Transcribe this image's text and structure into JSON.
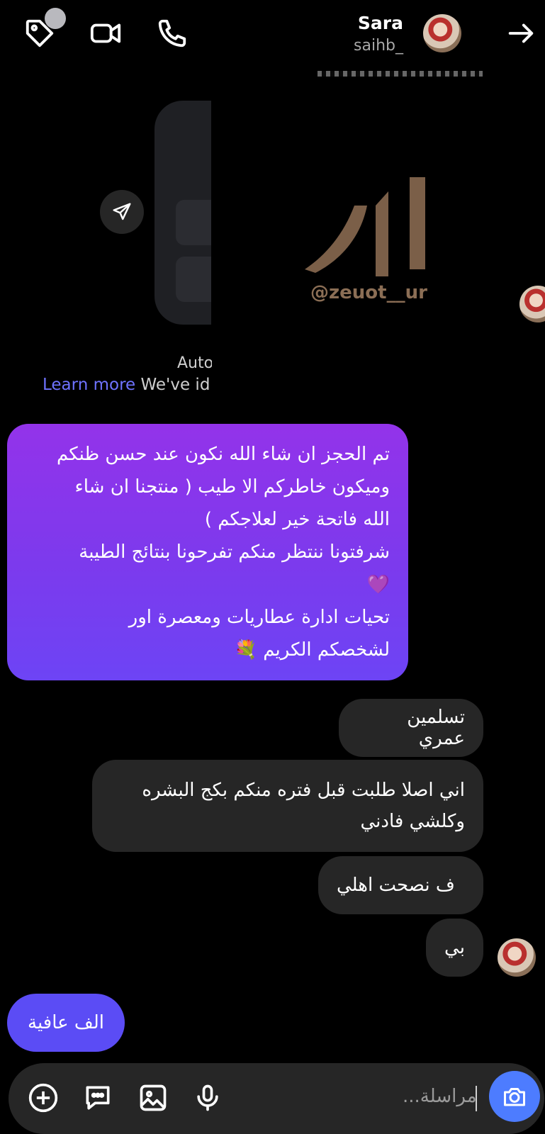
{
  "header": {
    "name": "Sara",
    "username": "saihb_"
  },
  "shared_post": {
    "logo_handle": "@zeuot__ur",
    "auto_text": "Auto",
    "learn_more": "Learn more",
    "learn_rest": "We've id"
  },
  "messages": {
    "sent_1_lines": [
      "تم الحجز ان شاء الله نكون عند حسن ظنكم",
      "وميكون خاطركم الا طيب ( منتجنا ان شاء",
      "الله فاتحة خير لعلاجكم )",
      "شرفتونا ننتظر منكم تفرحونا  بنتائج الطيبة",
      "💜",
      "تحيات ادارة عطاريات ومعصرة اور",
      "لشخصكم الكريم 💐"
    ],
    "received": [
      "تسلمين عمري",
      "اني اصلا طلبت قبل فتره منكم بكج البشره وكلشي فادني",
      "ف نصحت اهلي",
      "بي"
    ],
    "sent_2": "الف عافية"
  },
  "composer": {
    "placeholder": "مراسلة..."
  },
  "colors": {
    "background": "#000000",
    "bubble_received": "#262626",
    "bubble_sent_gradient_top": "#9333ea",
    "bubble_sent_gradient_bottom": "#6d44f5",
    "bubble_sent_small": "#5b4cf5",
    "link": "#6f73ff",
    "camera_button": "#4d7cff"
  },
  "icons": [
    "tag-icon",
    "video-call-icon",
    "phone-call-icon",
    "arrow-right-icon",
    "send-icon",
    "plus-icon",
    "sticker-icon",
    "gallery-icon",
    "microphone-icon",
    "camera-icon"
  ]
}
